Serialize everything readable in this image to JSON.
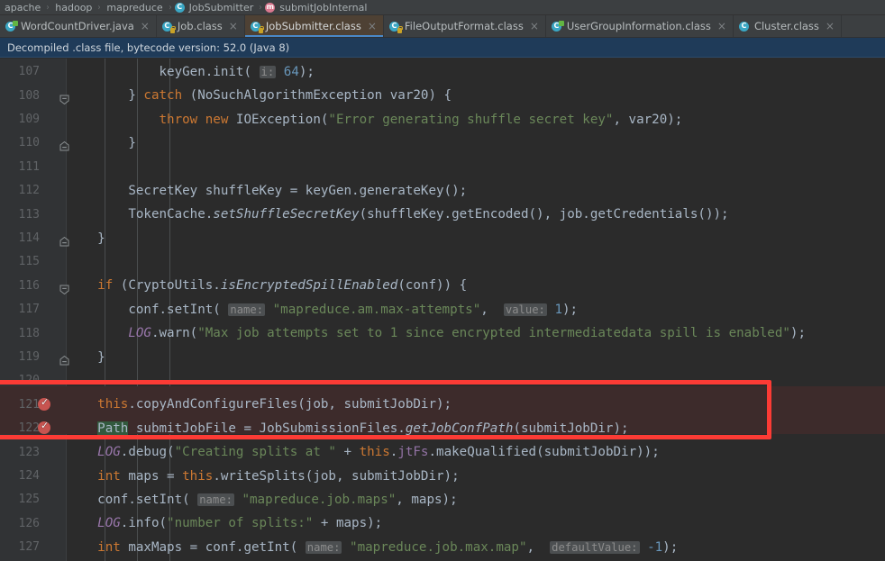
{
  "breadcrumb": {
    "items": [
      {
        "label": "apache",
        "icon": "none"
      },
      {
        "label": "hadoop",
        "icon": "none"
      },
      {
        "label": "mapreduce",
        "icon": "none"
      },
      {
        "label": "JobSubmitter",
        "icon": "class-icon",
        "glyph": "C"
      },
      {
        "label": "submitJobInternal",
        "icon": "method-icon",
        "glyph": "m"
      }
    ],
    "separator": "›"
  },
  "tabs": [
    {
      "label": "WordCountDriver.java",
      "icon": "java-file-icon",
      "glyph": "C",
      "badge": "green",
      "active": false,
      "close": "×"
    },
    {
      "label": "Job.class",
      "icon": "class-file-icon",
      "glyph": "C",
      "badge": "lock",
      "active": false,
      "close": "×"
    },
    {
      "label": "JobSubmitter.class",
      "icon": "class-file-icon",
      "glyph": "C",
      "badge": "lock",
      "active": true,
      "close": "×"
    },
    {
      "label": "FileOutputFormat.class",
      "icon": "class-file-icon",
      "glyph": "C",
      "badge": "lock",
      "active": false,
      "close": "×"
    },
    {
      "label": "UserGroupInformation.class",
      "icon": "class-file-icon",
      "glyph": "C",
      "badge": "green",
      "active": false,
      "close": "×"
    },
    {
      "label": "Cluster.class",
      "icon": "class-file-icon",
      "glyph": "C",
      "badge": "none",
      "active": false,
      "close": "×"
    }
  ],
  "notification": {
    "text": "Decompiled .class file, bytecode version: 52.0 (Java 8)"
  },
  "editor": {
    "first_line_number": 107,
    "lines": [
      {
        "n": "107",
        "fold": "none",
        "breakpoint": false,
        "highlight": false
      },
      {
        "n": "108",
        "fold": "start",
        "breakpoint": false,
        "highlight": false
      },
      {
        "n": "109",
        "fold": "none",
        "breakpoint": false,
        "highlight": false
      },
      {
        "n": "110",
        "fold": "end",
        "breakpoint": false,
        "highlight": false
      },
      {
        "n": "111",
        "fold": "none",
        "breakpoint": false,
        "highlight": false
      },
      {
        "n": "112",
        "fold": "none",
        "breakpoint": false,
        "highlight": false
      },
      {
        "n": "113",
        "fold": "none",
        "breakpoint": false,
        "highlight": false
      },
      {
        "n": "114",
        "fold": "end",
        "breakpoint": false,
        "highlight": false
      },
      {
        "n": "115",
        "fold": "none",
        "breakpoint": false,
        "highlight": false
      },
      {
        "n": "116",
        "fold": "start",
        "breakpoint": false,
        "highlight": false
      },
      {
        "n": "117",
        "fold": "none",
        "breakpoint": false,
        "highlight": false
      },
      {
        "n": "118",
        "fold": "none",
        "breakpoint": false,
        "highlight": false
      },
      {
        "n": "119",
        "fold": "end",
        "breakpoint": false,
        "highlight": false
      },
      {
        "n": "120",
        "fold": "none",
        "breakpoint": false,
        "highlight": false
      },
      {
        "n": "121",
        "fold": "none",
        "breakpoint": true,
        "highlight": true
      },
      {
        "n": "122",
        "fold": "none",
        "breakpoint": true,
        "highlight": true
      },
      {
        "n": "123",
        "fold": "none",
        "breakpoint": false,
        "highlight": false
      },
      {
        "n": "124",
        "fold": "none",
        "breakpoint": false,
        "highlight": false
      },
      {
        "n": "125",
        "fold": "none",
        "breakpoint": false,
        "highlight": false
      },
      {
        "n": "126",
        "fold": "none",
        "breakpoint": false,
        "highlight": false
      },
      {
        "n": "127",
        "fold": "none",
        "breakpoint": false,
        "highlight": false
      }
    ],
    "code_text": [
      "            keyGen.init( i: 64);",
      "        } catch (NoSuchAlgorithmException var20) {",
      "            throw new IOException(\"Error generating shuffle secret key\", var20);",
      "        }",
      "",
      "        SecretKey shuffleKey = keyGen.generateKey();",
      "        TokenCache.setShuffleSecretKey(shuffleKey.getEncoded(), job.getCredentials());",
      "    }",
      "",
      "    if (CryptoUtils.isEncryptedSpillEnabled(conf)) {",
      "        conf.setInt( name: \"mapreduce.am.max-attempts\", value: 1);",
      "        LOG.warn(\"Max job attempts set to 1 since encrypted intermediatedata spill is enabled\");",
      "    }",
      "",
      "    this.copyAndConfigureFiles(job, submitJobDir);",
      "    Path submitJobFile = JobSubmissionFiles.getJobConfPath(submitJobDir);",
      "    LOG.debug(\"Creating splits at \" + this.jtFs.makeQualified(submitJobDir));",
      "    int maps = this.writeSplits(job, submitJobDir);",
      "    conf.setInt( name: \"mapreduce.job.maps\", maps);",
      "    LOG.info(\"number of splits:\" + maps);",
      "    int maxMaps = conf.getInt( name: \"mapreduce.job.max.map\", defaultValue: -1);"
    ],
    "parameter_hints": [
      "i:",
      "name:",
      "value:",
      "name:",
      "name:",
      "defaultValue:"
    ],
    "selected_token": "Path",
    "colors": {
      "background": "#2b2b2b",
      "gutter": "#313335",
      "keyword": "#cc7832",
      "string": "#6a8759",
      "number": "#6897bb",
      "static_field": "#9876aa",
      "default_text": "#a9b7c6",
      "annotation_box": "#fc3b35",
      "highlight_row": "#3d2b2b",
      "selection": "#32593d",
      "active_tab": "#4e4134",
      "notification_bar": "#1f3b59"
    }
  }
}
